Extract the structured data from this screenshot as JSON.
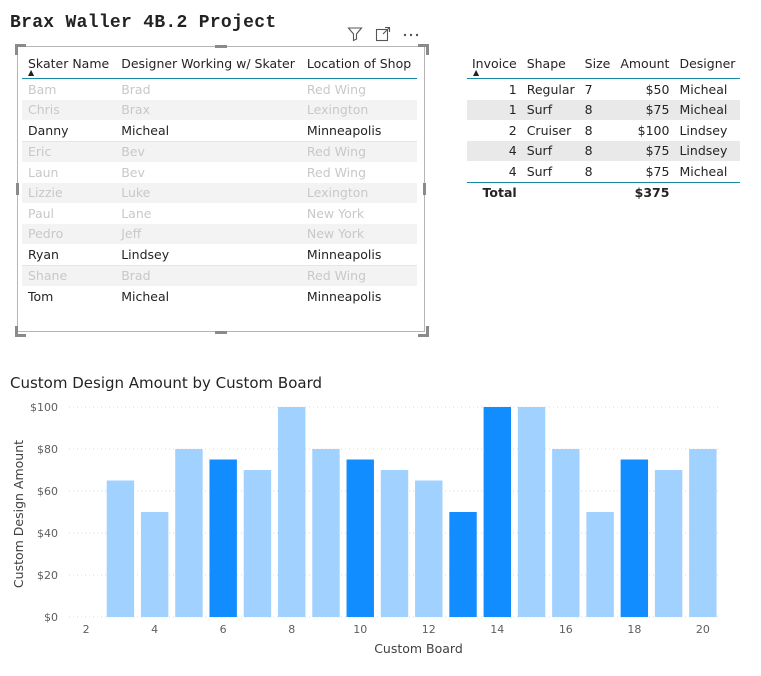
{
  "page": {
    "title": "Brax Waller 4B.2 Project"
  },
  "visual_header": {
    "icons": [
      "filter-icon",
      "focus-mode-icon",
      "more-options-icon"
    ]
  },
  "skater_table": {
    "columns": [
      "Skater Name",
      "Designer Working w/ Skater",
      "Location of Shop"
    ],
    "sort_column": "Skater Name",
    "rows": [
      [
        "Bam",
        "Brad",
        "Red Wing"
      ],
      [
        "Chris",
        "Brax",
        "Lexington"
      ],
      [
        "Danny",
        "Micheal",
        "Minneapolis"
      ],
      [
        "Eric",
        "Bev",
        "Red Wing"
      ],
      [
        "Laun",
        "Bev",
        "Red Wing"
      ],
      [
        "Lizzie",
        "Luke",
        "Lexington"
      ],
      [
        "Paul",
        "Lane",
        "New York"
      ],
      [
        "Pedro",
        "Jeff",
        "New York"
      ],
      [
        "Ryan",
        "Lindsey",
        "Minneapolis"
      ],
      [
        "Shane",
        "Brad",
        "Red Wing"
      ],
      [
        "Tom",
        "Micheal",
        "Minneapolis"
      ]
    ],
    "highlighted_rows": [
      "Danny",
      "Ryan",
      "Tom"
    ]
  },
  "invoice_table": {
    "columns": [
      "Invoice",
      "Shape",
      "Size",
      "Amount",
      "Designer"
    ],
    "sort_column": "Invoice",
    "rows": [
      [
        "1",
        "Regular",
        "7",
        "$50",
        "Micheal"
      ],
      [
        "1",
        "Surf",
        "8",
        "$75",
        "Micheal"
      ],
      [
        "2",
        "Cruiser",
        "8",
        "$100",
        "Lindsey"
      ],
      [
        "4",
        "Surf",
        "8",
        "$75",
        "Lindsey"
      ],
      [
        "4",
        "Surf",
        "8",
        "$75",
        "Micheal"
      ]
    ],
    "total": {
      "label": "Total",
      "amount": "$375"
    }
  },
  "colors": {
    "highlight": "#118dff",
    "dimmed": "#a0d1ff",
    "header_rule": "#1a89a5"
  },
  "chart_data": {
    "type": "bar",
    "title": "Custom Design Amount by Custom Board",
    "xlabel": "Custom Board",
    "ylabel": "Custom Design Amount",
    "x": [
      3,
      4,
      5,
      6,
      7,
      8,
      9,
      10,
      11,
      12,
      13,
      14,
      15,
      16,
      17,
      18,
      19,
      20
    ],
    "values": [
      65,
      50,
      80,
      75,
      70,
      100,
      80,
      75,
      70,
      65,
      50,
      100,
      100,
      80,
      50,
      75,
      70,
      80
    ],
    "highlighted": [
      false,
      false,
      false,
      true,
      false,
      false,
      false,
      true,
      false,
      false,
      true,
      true,
      false,
      false,
      false,
      true,
      false,
      false
    ],
    "xticks": [
      2,
      4,
      6,
      8,
      10,
      12,
      14,
      16,
      18,
      20
    ],
    "yticks": [
      "$0",
      "$20",
      "$40",
      "$60",
      "$80",
      "$100"
    ],
    "ylim": [
      0,
      100
    ],
    "xlim": [
      2,
      20
    ],
    "grid": true
  }
}
